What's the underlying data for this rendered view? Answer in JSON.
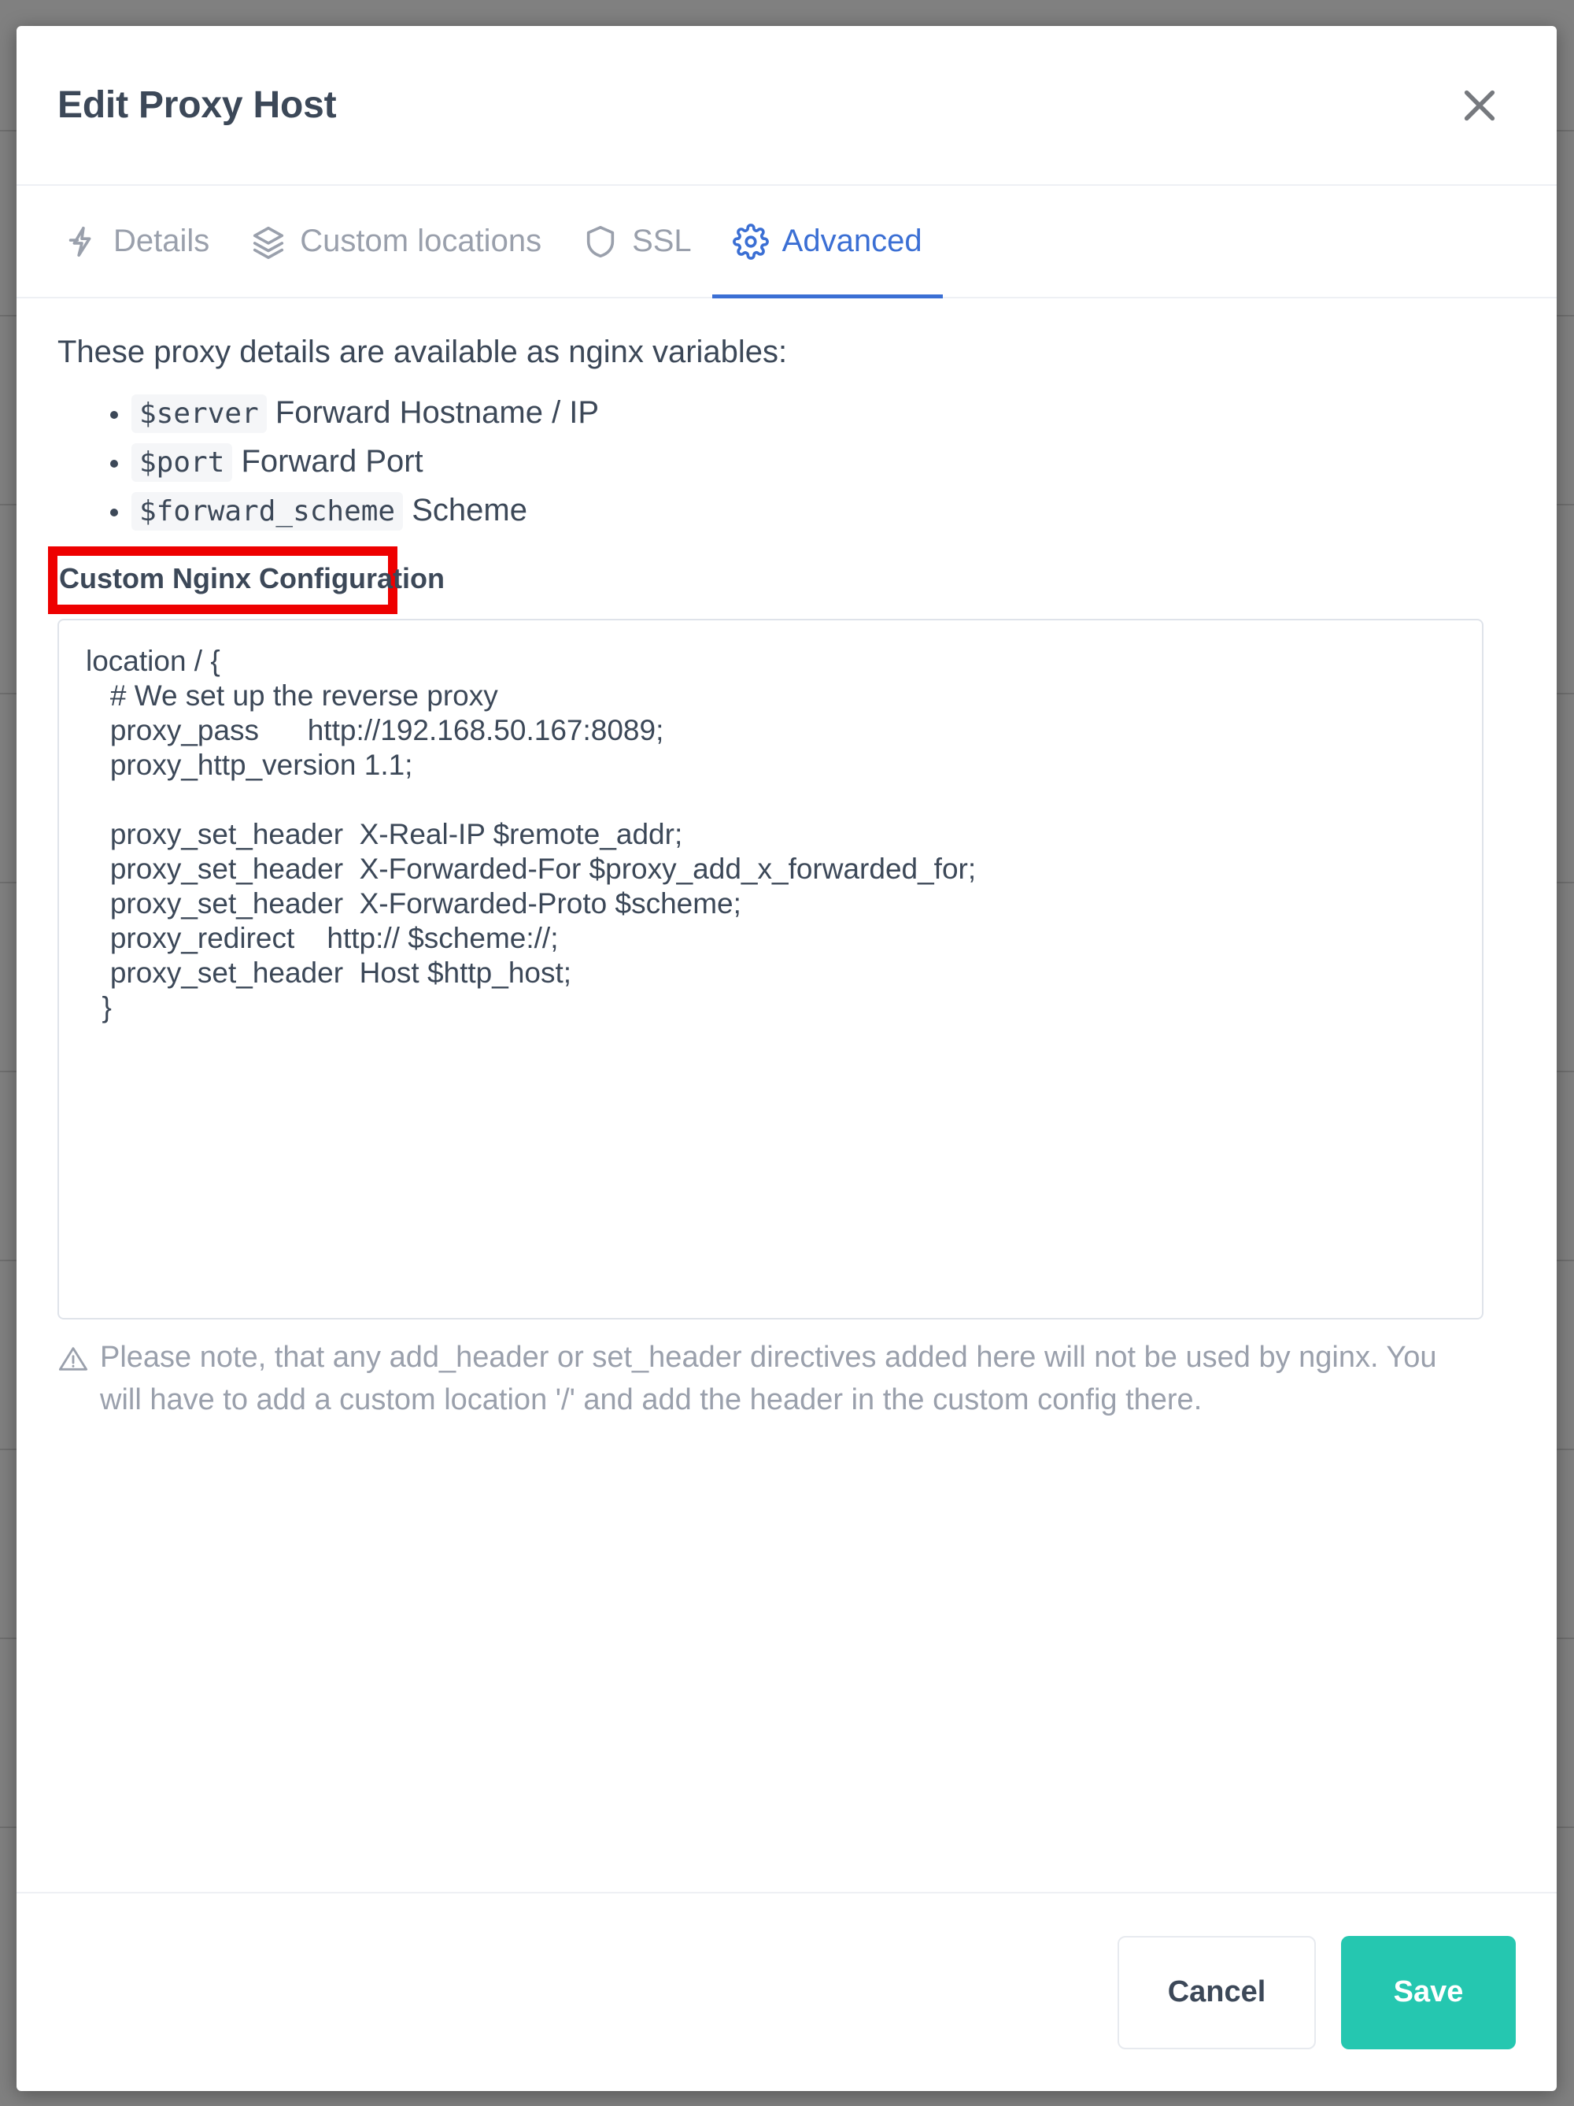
{
  "backdrop": {
    "color": "#808080"
  },
  "modal": {
    "title": "Edit Proxy Host",
    "close_icon": "close-icon"
  },
  "tabs": [
    {
      "label": "Details",
      "icon": "lightning-bolt-icon",
      "active": false
    },
    {
      "label": "Custom locations",
      "icon": "layers-stack-icon",
      "active": false
    },
    {
      "label": "SSL",
      "icon": "shield-icon",
      "active": false
    },
    {
      "label": "Advanced",
      "icon": "gear-icon",
      "active": true
    }
  ],
  "body": {
    "intro": "These proxy details are available as nginx variables:",
    "variables": [
      {
        "code": "$server",
        "description": "Forward Hostname / IP"
      },
      {
        "code": "$port",
        "description": "Forward Port"
      },
      {
        "code": "$forward_scheme",
        "description": "Scheme"
      }
    ],
    "section_heading": "Custom Nginx Configuration",
    "config_value": "location / {\n   # We set up the reverse proxy\n   proxy_pass      http://192.168.50.167:8089;\n   proxy_http_version 1.1;\n\n   proxy_set_header  X-Real-IP $remote_addr;\n   proxy_set_header  X-Forwarded-For $proxy_add_x_forwarded_for;\n   proxy_set_header  X-Forwarded-Proto $scheme;\n   proxy_redirect    http:// $scheme://;\n   proxy_set_header  Host $http_host;\n  }",
    "note": "Please note, that any add_header or set_header directives added here will not be used by nginx. You will have to add a custom location '/' and add the header in the custom config there.",
    "note_icon": "warning-triangle-icon"
  },
  "footer": {
    "cancel_label": "Cancel",
    "save_label": "Save"
  },
  "colors": {
    "accent_blue": "#3b6fd4",
    "save_green": "#25c7b0",
    "annotation_red": "#ee0000",
    "text_dark": "#3c4858",
    "text_muted": "#9aa0ac"
  }
}
